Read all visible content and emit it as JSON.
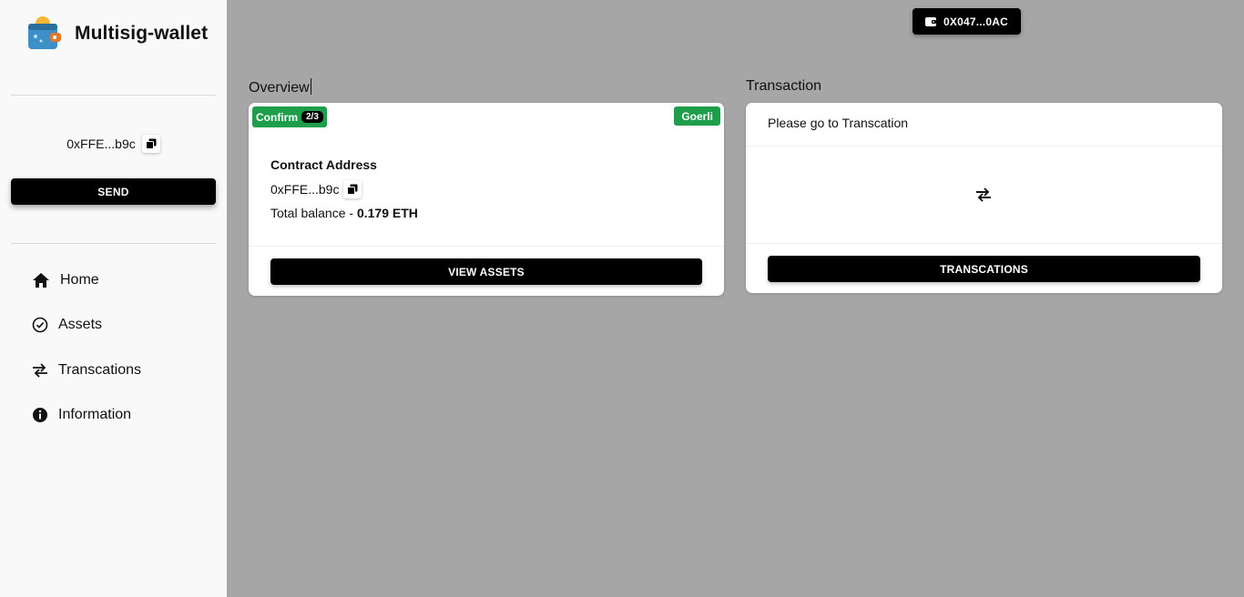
{
  "app": {
    "title": "Multisig-wallet"
  },
  "sidebar": {
    "account_address": "0xFFE...b9c",
    "send_label": "SEND",
    "nav": [
      {
        "label": "Home",
        "icon": "home-icon"
      },
      {
        "label": "Assets",
        "icon": "check-circle-icon"
      },
      {
        "label": "Transcations",
        "icon": "swap-arrows-icon"
      },
      {
        "label": "Information",
        "icon": "info-icon"
      }
    ]
  },
  "header": {
    "wallet_label": "0X047...0AC",
    "wallet_icon": "wallet-icon"
  },
  "overview": {
    "title": "Overview",
    "confirm_label": "Confirm",
    "confirm_count": "2/3",
    "network": "Goerli",
    "contract_label": "Contract Address",
    "contract_address": "0xFFE...b9c",
    "balance_prefix": "Total balance - ",
    "balance_value": "0.179 ETH",
    "button_label": "VIEW ASSETS"
  },
  "transaction": {
    "title": "Transaction",
    "text": "Please go to Transcation",
    "icon": "swap-arrows-icon",
    "button_label": "TRANSCATIONS"
  },
  "colors": {
    "background": "#a6a6a6",
    "sidebar": "#f9f9f9",
    "badge_green": "#1e9e4a",
    "button": "#000000"
  }
}
